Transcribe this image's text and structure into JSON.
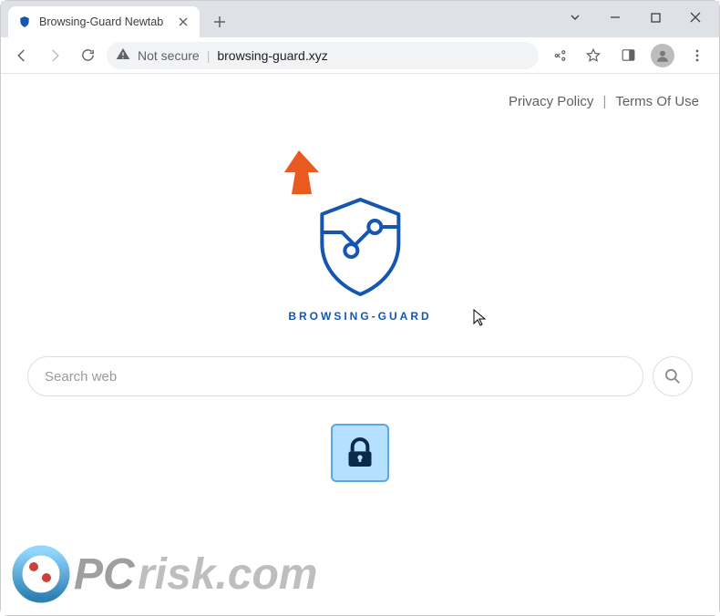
{
  "browser": {
    "tab_title": "Browsing-Guard Newtab",
    "security_label": "Not secure",
    "url": "browsing-guard.xyz"
  },
  "header": {
    "links": {
      "privacy": "Privacy Policy",
      "terms": "Terms Of Use",
      "separator": "|"
    }
  },
  "logo": {
    "text": "BROWSING-GUARD"
  },
  "search": {
    "placeholder": "Search web"
  },
  "icons": {
    "favicon": "shield-favicon",
    "close": "close-icon",
    "newtab": "plus-icon",
    "chevron": "chevron-down-icon",
    "minimize": "minimize-icon",
    "maximize": "maximize-icon",
    "windowclose": "close-icon",
    "back": "arrow-left-icon",
    "forward": "arrow-right-icon",
    "reload": "reload-icon",
    "warning": "warning-triangle-icon",
    "share": "share-icon",
    "star": "star-icon",
    "panel": "side-panel-icon",
    "avatar": "avatar-icon",
    "kebab": "kebab-menu-icon",
    "search": "search-icon",
    "lock": "padlock-icon"
  },
  "watermark": {
    "text": "PCrisk.com"
  },
  "colors": {
    "brand_blue": "#1557b0",
    "tile_bg": "#b6e0ff",
    "arrow": "#e85a1f"
  }
}
